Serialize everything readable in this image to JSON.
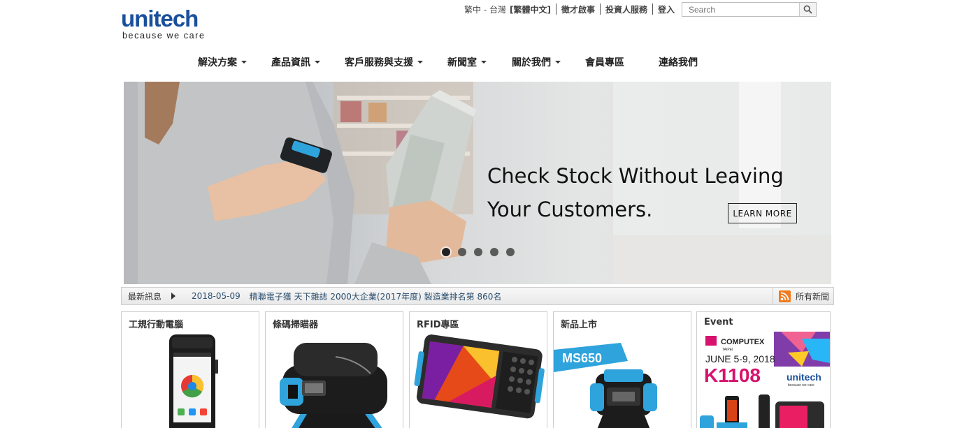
{
  "brand": {
    "name": "unitech",
    "tagline": "because we care"
  },
  "top_links": {
    "region": "繁中 - 台灣",
    "lang_current": "[繁體中文]",
    "recruit": "徵才啟事",
    "investor": "投資人服務",
    "login": "登入"
  },
  "search": {
    "placeholder": "Search"
  },
  "nav": [
    {
      "label": "解決方案",
      "has_dropdown": true
    },
    {
      "label": "產品資訊",
      "has_dropdown": true
    },
    {
      "label": "客戶服務與支援",
      "has_dropdown": true
    },
    {
      "label": "新聞室",
      "has_dropdown": true
    },
    {
      "label": "關於我們",
      "has_dropdown": true
    },
    {
      "label": "會員專區",
      "has_dropdown": false
    },
    {
      "label": "連絡我們",
      "has_dropdown": false
    }
  ],
  "hero": {
    "title_line1": "Check Stock Without Leaving",
    "title_line2": "Your Customers.",
    "button": "LEARN MORE",
    "slides": 5,
    "active_slide": 1
  },
  "news": {
    "label": "最新訊息",
    "date": "2018-05-09",
    "text": "精聯電子獲 天下雜誌 2000大企業(2017年度) 製造業排名第 860名",
    "all_label": "所有新聞"
  },
  "cards": [
    {
      "title": "工規行動電腦"
    },
    {
      "title": "條碼掃瞄器"
    },
    {
      "title": "RFID專區"
    },
    {
      "title": "新品上市",
      "badge": "MS650"
    },
    {
      "title": "Event",
      "event_name": "COMPUTEX",
      "event_city": "TAIPEI",
      "event_date": "JUNE 5-9, 2018",
      "booth": "K1108",
      "brand": "unitech",
      "brand_tagline": "because we care"
    }
  ],
  "colors": {
    "brand_blue": "#1a4f9c",
    "news_link": "#2c4f6e",
    "rss_orange": "#f07b20",
    "accent_cyan": "#2ea3dc",
    "event_magenta": "#d6126e"
  }
}
